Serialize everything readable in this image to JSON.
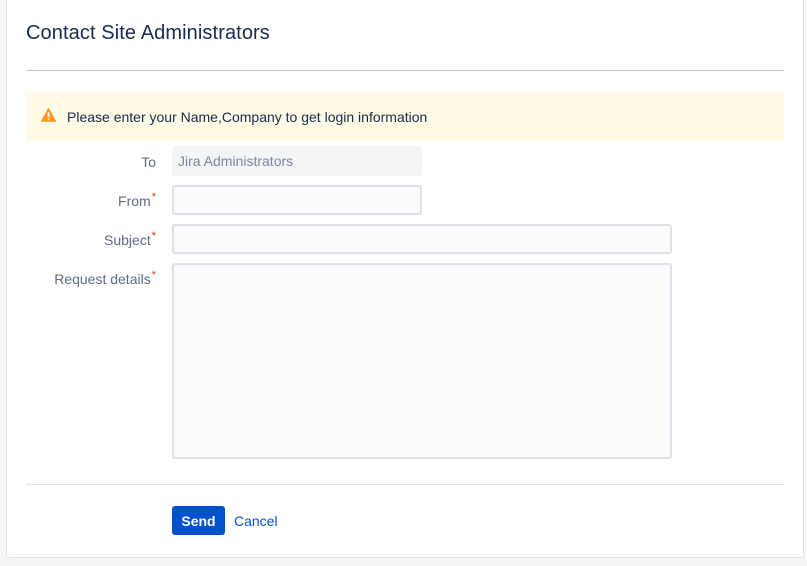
{
  "dialog": {
    "title": "Contact Site Administrators",
    "warning": {
      "icon": "warning-icon",
      "text": "Please enter your Name,Company to get login information",
      "color": "#ff991f"
    },
    "form": {
      "to": {
        "label": "To",
        "value": "Jira Administrators"
      },
      "from": {
        "label": "From",
        "required_mark": "*",
        "value": ""
      },
      "subject": {
        "label": "Subject",
        "required_mark": "*",
        "value": ""
      },
      "details": {
        "label": "Request details",
        "required_mark": "*",
        "value": ""
      }
    },
    "actions": {
      "send_label": "Send",
      "cancel_label": "Cancel"
    }
  },
  "colors": {
    "primary": "#0052cc",
    "warning_bg": "#fffae6",
    "required": "#de350b"
  }
}
